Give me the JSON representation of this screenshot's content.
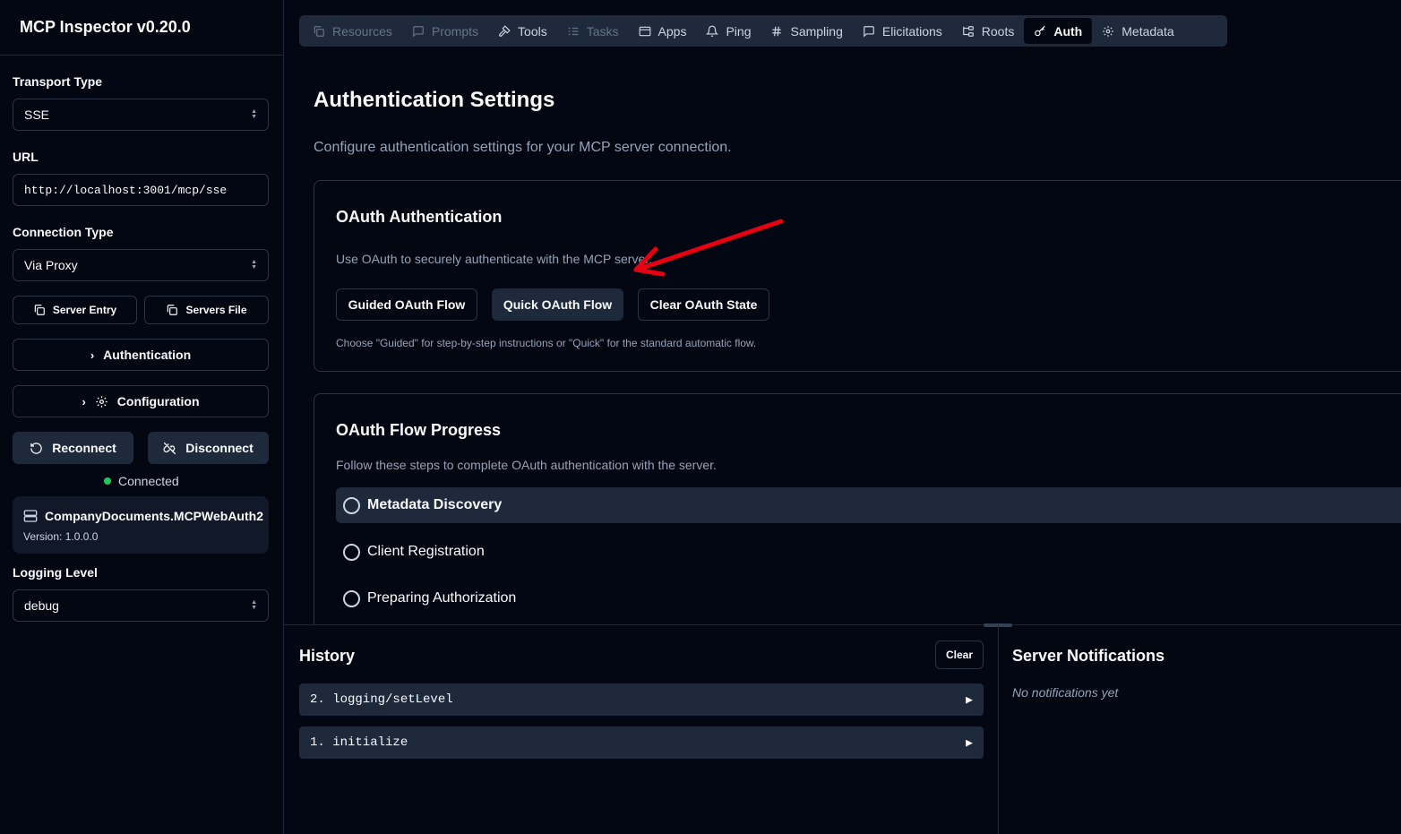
{
  "app": {
    "title": "MCP Inspector v0.20.0"
  },
  "sidebar": {
    "transport_label": "Transport Type",
    "transport_value": "SSE",
    "url_label": "URL",
    "url_value": "http://localhost:3001/mcp/sse",
    "connection_label": "Connection Type",
    "connection_value": "Via Proxy",
    "server_entry_label": "Server Entry",
    "servers_file_label": "Servers File",
    "authentication_label": "Authentication",
    "configuration_label": "Configuration",
    "reconnect_label": "Reconnect",
    "disconnect_label": "Disconnect",
    "status_text": "Connected",
    "status_color": "#22c55e",
    "server_name": "CompanyDocuments.MCPWebAuth2",
    "server_version": "Version: 1.0.0.0",
    "logging_label": "Logging Level",
    "logging_value": "debug"
  },
  "tabs": [
    {
      "label": "Resources",
      "icon": "copy-icon",
      "state": "disabled"
    },
    {
      "label": "Prompts",
      "icon": "message-icon",
      "state": "disabled"
    },
    {
      "label": "Tools",
      "icon": "hammer-icon",
      "state": "normal"
    },
    {
      "label": "Tasks",
      "icon": "list-icon",
      "state": "disabled"
    },
    {
      "label": "Apps",
      "icon": "app-window-icon",
      "state": "normal"
    },
    {
      "label": "Ping",
      "icon": "bell-icon",
      "state": "normal"
    },
    {
      "label": "Sampling",
      "icon": "hash-icon",
      "state": "normal"
    },
    {
      "label": "Elicitations",
      "icon": "message-icon",
      "state": "normal"
    },
    {
      "label": "Roots",
      "icon": "folder-tree-icon",
      "state": "normal"
    },
    {
      "label": "Auth",
      "icon": "key-icon",
      "state": "active"
    },
    {
      "label": "Metadata",
      "icon": "gear-icon",
      "state": "normal"
    }
  ],
  "main": {
    "title": "Authentication Settings",
    "description": "Configure authentication settings for your MCP server connection.",
    "oauth": {
      "title": "OAuth Authentication",
      "description": "Use OAuth to securely authenticate with the MCP server.",
      "guided_label": "Guided OAuth Flow",
      "quick_label": "Quick OAuth Flow",
      "clear_label": "Clear OAuth State",
      "note": "Choose \"Guided\" for step-by-step instructions or \"Quick\" for the standard automatic flow."
    },
    "progress": {
      "title": "OAuth Flow Progress",
      "description": "Follow these steps to complete OAuth authentication with the server.",
      "steps": [
        "Metadata Discovery",
        "Client Registration",
        "Preparing Authorization"
      ]
    }
  },
  "history": {
    "title": "History",
    "clear_label": "Clear",
    "items": [
      "2. logging/setLevel",
      "1. initialize"
    ]
  },
  "notifications": {
    "title": "Server Notifications",
    "empty_text": "No notifications yet"
  },
  "annotation": {
    "arrow_color": "#e60012"
  }
}
